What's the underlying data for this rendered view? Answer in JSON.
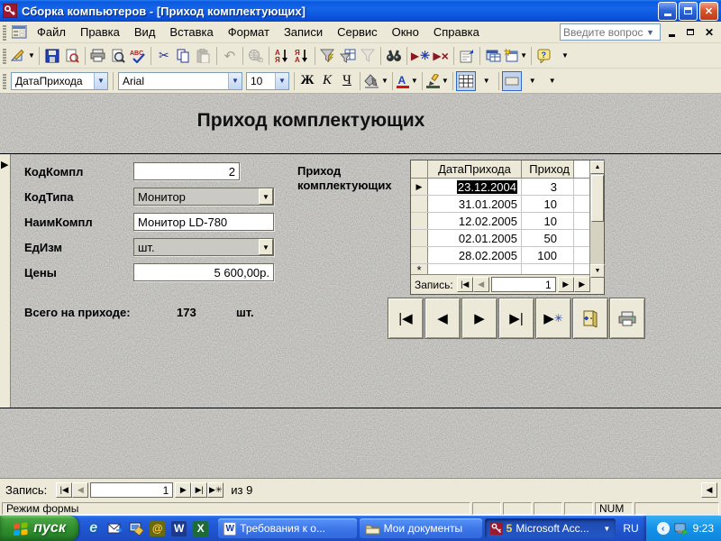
{
  "window": {
    "title": "Сборка компьютеров - [Приход комплектующих]"
  },
  "menubar": {
    "items": [
      "Файл",
      "Правка",
      "Вид",
      "Вставка",
      "Формат",
      "Записи",
      "Сервис",
      "Окно",
      "Справка"
    ],
    "question_box": {
      "placeholder": "Введите вопрос"
    }
  },
  "toolbar_std": {
    "icons": [
      "form-view",
      "save",
      "file-search",
      "print",
      "print-preview",
      "spelling",
      "cut",
      "copy",
      "paste",
      "undo",
      "insert-hyperlink",
      "sort-ascending",
      "sort-descending",
      "filter-by-selection",
      "filter-by-form",
      "apply-filter",
      "find",
      "new-record",
      "delete-record",
      "properties",
      "database-window",
      "new-object",
      "help",
      "toolbar-options"
    ],
    "sort_asc_top": "А",
    "sort_asc_bottom": "Я",
    "sort_desc_top": "Я",
    "sort_desc_bottom": "А"
  },
  "toolbar_fmt": {
    "field_selector": "ДатаПрихода",
    "font_name": "Arial",
    "font_size": "10",
    "bold": "Ж",
    "italic": "К",
    "underline": "Ч",
    "font_color_letter": "А"
  },
  "form": {
    "title": "Приход комплектующих",
    "fields": [
      {
        "label": "КодКомпл",
        "value": "2"
      },
      {
        "label": "КодТипа",
        "value": "Монитор"
      },
      {
        "label": "НаимКомпл",
        "value": "Монитор LD-780"
      },
      {
        "label": "ЕдИзм",
        "value": "шт."
      },
      {
        "label": "Цены",
        "value": "5 600,00р."
      }
    ],
    "subform": {
      "label_line1": "Приход",
      "label_line2": "комплектующих",
      "columns": [
        "ДатаПрихода",
        "Приход"
      ],
      "rows": [
        {
          "date": "23.12.2004",
          "qty": "3"
        },
        {
          "date": "31.01.2005",
          "qty": "10"
        },
        {
          "date": "12.02.2005",
          "qty": "10"
        },
        {
          "date": "02.01.2005",
          "qty": "50"
        },
        {
          "date": "28.02.2005",
          "qty": "100"
        }
      ],
      "new_row_marker": "*",
      "nav": {
        "label": "Запись:",
        "current": "1"
      }
    },
    "total": {
      "label": "Всего на приходе:",
      "value": "173",
      "unit": "шт."
    }
  },
  "record_nav": {
    "label": "Запись:",
    "current": "1",
    "of": "из 9"
  },
  "status_bar": {
    "mode": "Режим формы",
    "num": "NUM"
  },
  "taskbar": {
    "start": "пуск",
    "quick_launch": [
      "internet-explorer",
      "outlook-express",
      "show-desktop",
      "mail",
      "word",
      "excel"
    ],
    "tasks": [
      {
        "label": "Требования к о...",
        "icon": "word-document"
      },
      {
        "label": "Мои документы",
        "icon": "folder"
      },
      {
        "count": "5",
        "label": "Microsoft Acc...",
        "icon": "access"
      }
    ],
    "language": "RU",
    "time": "9:23"
  }
}
